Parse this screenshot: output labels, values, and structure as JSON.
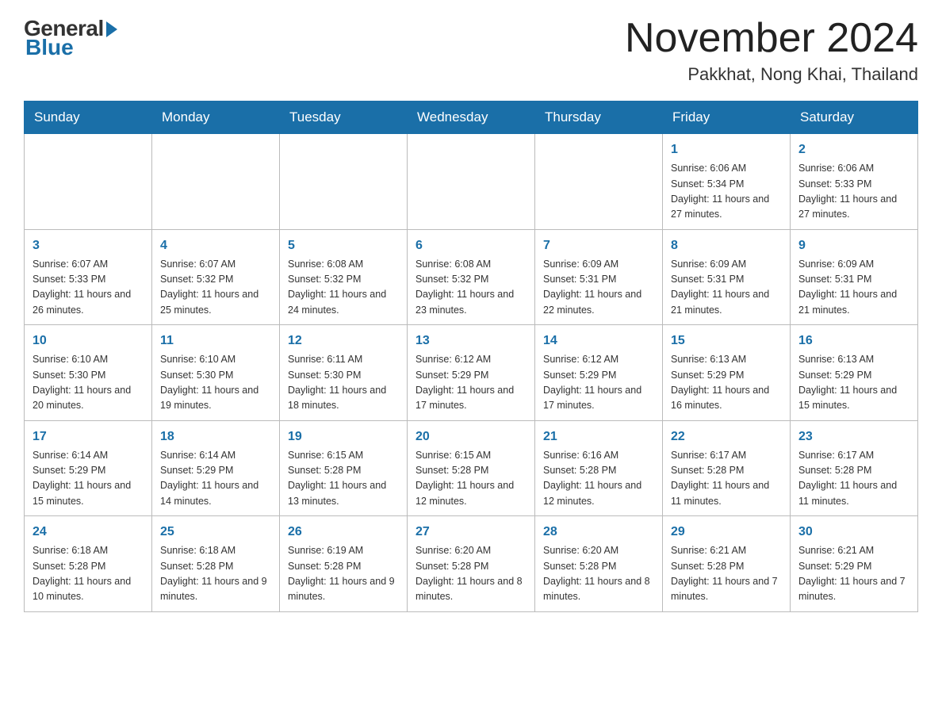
{
  "header": {
    "logo_general": "General",
    "logo_blue": "Blue",
    "month_title": "November 2024",
    "location": "Pakkhat, Nong Khai, Thailand"
  },
  "days_of_week": [
    "Sunday",
    "Monday",
    "Tuesday",
    "Wednesday",
    "Thursday",
    "Friday",
    "Saturday"
  ],
  "weeks": [
    [
      null,
      null,
      null,
      null,
      null,
      {
        "day": "1",
        "sunrise": "Sunrise: 6:06 AM",
        "sunset": "Sunset: 5:34 PM",
        "daylight": "Daylight: 11 hours and 27 minutes."
      },
      {
        "day": "2",
        "sunrise": "Sunrise: 6:06 AM",
        "sunset": "Sunset: 5:33 PM",
        "daylight": "Daylight: 11 hours and 27 minutes."
      }
    ],
    [
      {
        "day": "3",
        "sunrise": "Sunrise: 6:07 AM",
        "sunset": "Sunset: 5:33 PM",
        "daylight": "Daylight: 11 hours and 26 minutes."
      },
      {
        "day": "4",
        "sunrise": "Sunrise: 6:07 AM",
        "sunset": "Sunset: 5:32 PM",
        "daylight": "Daylight: 11 hours and 25 minutes."
      },
      {
        "day": "5",
        "sunrise": "Sunrise: 6:08 AM",
        "sunset": "Sunset: 5:32 PM",
        "daylight": "Daylight: 11 hours and 24 minutes."
      },
      {
        "day": "6",
        "sunrise": "Sunrise: 6:08 AM",
        "sunset": "Sunset: 5:32 PM",
        "daylight": "Daylight: 11 hours and 23 minutes."
      },
      {
        "day": "7",
        "sunrise": "Sunrise: 6:09 AM",
        "sunset": "Sunset: 5:31 PM",
        "daylight": "Daylight: 11 hours and 22 minutes."
      },
      {
        "day": "8",
        "sunrise": "Sunrise: 6:09 AM",
        "sunset": "Sunset: 5:31 PM",
        "daylight": "Daylight: 11 hours and 21 minutes."
      },
      {
        "day": "9",
        "sunrise": "Sunrise: 6:09 AM",
        "sunset": "Sunset: 5:31 PM",
        "daylight": "Daylight: 11 hours and 21 minutes."
      }
    ],
    [
      {
        "day": "10",
        "sunrise": "Sunrise: 6:10 AM",
        "sunset": "Sunset: 5:30 PM",
        "daylight": "Daylight: 11 hours and 20 minutes."
      },
      {
        "day": "11",
        "sunrise": "Sunrise: 6:10 AM",
        "sunset": "Sunset: 5:30 PM",
        "daylight": "Daylight: 11 hours and 19 minutes."
      },
      {
        "day": "12",
        "sunrise": "Sunrise: 6:11 AM",
        "sunset": "Sunset: 5:30 PM",
        "daylight": "Daylight: 11 hours and 18 minutes."
      },
      {
        "day": "13",
        "sunrise": "Sunrise: 6:12 AM",
        "sunset": "Sunset: 5:29 PM",
        "daylight": "Daylight: 11 hours and 17 minutes."
      },
      {
        "day": "14",
        "sunrise": "Sunrise: 6:12 AM",
        "sunset": "Sunset: 5:29 PM",
        "daylight": "Daylight: 11 hours and 17 minutes."
      },
      {
        "day": "15",
        "sunrise": "Sunrise: 6:13 AM",
        "sunset": "Sunset: 5:29 PM",
        "daylight": "Daylight: 11 hours and 16 minutes."
      },
      {
        "day": "16",
        "sunrise": "Sunrise: 6:13 AM",
        "sunset": "Sunset: 5:29 PM",
        "daylight": "Daylight: 11 hours and 15 minutes."
      }
    ],
    [
      {
        "day": "17",
        "sunrise": "Sunrise: 6:14 AM",
        "sunset": "Sunset: 5:29 PM",
        "daylight": "Daylight: 11 hours and 15 minutes."
      },
      {
        "day": "18",
        "sunrise": "Sunrise: 6:14 AM",
        "sunset": "Sunset: 5:29 PM",
        "daylight": "Daylight: 11 hours and 14 minutes."
      },
      {
        "day": "19",
        "sunrise": "Sunrise: 6:15 AM",
        "sunset": "Sunset: 5:28 PM",
        "daylight": "Daylight: 11 hours and 13 minutes."
      },
      {
        "day": "20",
        "sunrise": "Sunrise: 6:15 AM",
        "sunset": "Sunset: 5:28 PM",
        "daylight": "Daylight: 11 hours and 12 minutes."
      },
      {
        "day": "21",
        "sunrise": "Sunrise: 6:16 AM",
        "sunset": "Sunset: 5:28 PM",
        "daylight": "Daylight: 11 hours and 12 minutes."
      },
      {
        "day": "22",
        "sunrise": "Sunrise: 6:17 AM",
        "sunset": "Sunset: 5:28 PM",
        "daylight": "Daylight: 11 hours and 11 minutes."
      },
      {
        "day": "23",
        "sunrise": "Sunrise: 6:17 AM",
        "sunset": "Sunset: 5:28 PM",
        "daylight": "Daylight: 11 hours and 11 minutes."
      }
    ],
    [
      {
        "day": "24",
        "sunrise": "Sunrise: 6:18 AM",
        "sunset": "Sunset: 5:28 PM",
        "daylight": "Daylight: 11 hours and 10 minutes."
      },
      {
        "day": "25",
        "sunrise": "Sunrise: 6:18 AM",
        "sunset": "Sunset: 5:28 PM",
        "daylight": "Daylight: 11 hours and 9 minutes."
      },
      {
        "day": "26",
        "sunrise": "Sunrise: 6:19 AM",
        "sunset": "Sunset: 5:28 PM",
        "daylight": "Daylight: 11 hours and 9 minutes."
      },
      {
        "day": "27",
        "sunrise": "Sunrise: 6:20 AM",
        "sunset": "Sunset: 5:28 PM",
        "daylight": "Daylight: 11 hours and 8 minutes."
      },
      {
        "day": "28",
        "sunrise": "Sunrise: 6:20 AM",
        "sunset": "Sunset: 5:28 PM",
        "daylight": "Daylight: 11 hours and 8 minutes."
      },
      {
        "day": "29",
        "sunrise": "Sunrise: 6:21 AM",
        "sunset": "Sunset: 5:28 PM",
        "daylight": "Daylight: 11 hours and 7 minutes."
      },
      {
        "day": "30",
        "sunrise": "Sunrise: 6:21 AM",
        "sunset": "Sunset: 5:29 PM",
        "daylight": "Daylight: 11 hours and 7 minutes."
      }
    ]
  ]
}
